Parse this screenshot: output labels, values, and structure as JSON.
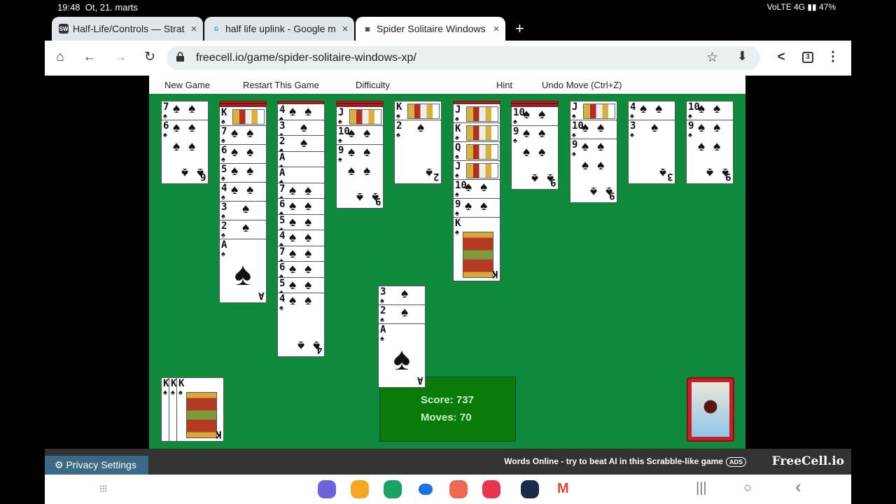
{
  "status": {
    "time": "19:48",
    "date": "Ot, 21. marts",
    "network": "VoLTE 4G",
    "battery": "47%"
  },
  "tabs": [
    {
      "favicon": "SW",
      "title": "Half-Life/Controls — Strat",
      "close": "×"
    },
    {
      "favicon": "G",
      "title": "half life uplink - Google m",
      "close": "×"
    },
    {
      "favicon": "▣",
      "title": "Spider Solitaire Windows",
      "close": "×",
      "active": true
    }
  ],
  "new_tab": "+",
  "toolbar": {
    "home": "⌂",
    "back": "←",
    "forward": "→",
    "reload": "↻",
    "url": "freecell.io/game/spider-solitaire-windows-xp/",
    "star": "☆",
    "download": "⬇",
    "share": "<",
    "tab_count": "3",
    "menu": "⋮"
  },
  "game_menu": {
    "new_game": "New Game",
    "restart": "Restart This Game",
    "difficulty": "Difficulty",
    "hint": "Hint",
    "undo": "Undo Move (Ctrl+Z)"
  },
  "suit": "♠",
  "tableau": [
    {
      "facedown": 0,
      "cards": [
        "7",
        "6"
      ]
    },
    {
      "facedown": 2,
      "cards": [
        "K",
        "7",
        "6",
        "5",
        "4",
        "3",
        "2",
        "A"
      ]
    },
    {
      "facedown": 1,
      "cards": [
        "4",
        "3",
        "2",
        "A",
        "A",
        "7",
        "6",
        "5",
        "4",
        "7",
        "6",
        "5",
        "4"
      ]
    },
    {
      "facedown": 2,
      "cards": [
        "J",
        "10",
        "9"
      ]
    },
    {
      "facedown": 0,
      "cards": [
        "K",
        "2"
      ]
    },
    {
      "facedown": 1,
      "cards": [
        "J",
        "K",
        "Q",
        "J",
        "10",
        "9",
        "K"
      ]
    },
    {
      "facedown": 2,
      "cards": [
        "10",
        "9"
      ]
    },
    {
      "facedown": 0,
      "cards": [
        "J",
        "10",
        "9"
      ]
    },
    {
      "facedown": 0,
      "cards": [
        "4",
        "3"
      ]
    },
    {
      "facedown": 0,
      "cards": [
        "10",
        "9"
      ]
    }
  ],
  "dragging": {
    "cards": [
      "3",
      "2",
      "A"
    ]
  },
  "completed": {
    "labels": [
      "K",
      "K",
      "K"
    ]
  },
  "score": {
    "score_label": "Score: 737",
    "moves_label": "Moves: 70"
  },
  "ad": {
    "privacy": "Privacy Settings",
    "text": "Words Online - try to beat AI in this Scrabble-like game",
    "badge": "ADS",
    "logo": "FreeCell.io"
  },
  "dock": [
    {
      "name": "internet",
      "color": "#6c63d9"
    },
    {
      "name": "files",
      "color": "#f5a623"
    },
    {
      "name": "phone",
      "color": "#1aa260"
    },
    {
      "name": "messages",
      "color": "#1f6fe5"
    },
    {
      "name": "contacts",
      "color": "#f0674f"
    },
    {
      "name": "camera",
      "color": "#e8344e"
    },
    {
      "name": "steam",
      "color": "#1b2a4a"
    },
    {
      "name": "gmail",
      "color": "#ea4335"
    }
  ],
  "nav": {
    "recents": "|||",
    "home": "○",
    "back": "‹"
  }
}
